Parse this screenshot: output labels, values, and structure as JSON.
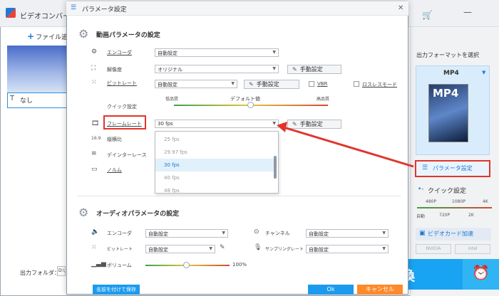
{
  "app": {
    "title": "ビデオコンバー",
    "add_file": "ファイル追",
    "subtitle_value": "なし",
    "output_folder_label": "出力フォルダ：",
    "output_folder_value": "D:\\"
  },
  "right_panel": {
    "format_title": "出力フォーマットを選択",
    "format_name": "MP4",
    "format_icon_label": "MP4",
    "param_button": "パラメータ設定",
    "quick_title": "クイック設定",
    "quick_labels": [
      "480P",
      "1080P",
      "4K",
      "自動",
      "720P",
      "2K"
    ],
    "gpu_label": "ビデオカード加速",
    "gpu_logos": [
      "NVIDIA",
      "intel"
    ],
    "convert_label": "変換"
  },
  "dialog": {
    "title": "パラメータ設定",
    "video_section": "動画パラメータの設定",
    "encoder_label": "エンコーダ",
    "encoder_value": "自動設定",
    "resolution_label": "解像度",
    "resolution_value": "オリジナル",
    "manual_label": "手動設定",
    "bitrate_label": "ビットレート",
    "bitrate_value": "自動設定",
    "vbr_label": "VBR",
    "lossless_label": "ロスレスモード",
    "quick_label": "クイック設定",
    "low_quality": "低品質",
    "default_value": "デフォルト値",
    "high_quality": "高品質",
    "framerate_label": "フレームレート",
    "framerate_value": "30 fps",
    "aspect_label": "縦横比",
    "deinterlace_label": "デインターレース",
    "normal_label": "ノルム",
    "framerate_options": [
      "25 fps",
      "29.97 fps",
      "30 fps",
      "40 fps",
      "48 fps"
    ],
    "framerate_selected_index": 2,
    "audio_section": "オーディオパラメータの設定",
    "a_encoder_label": "エンコーダ",
    "a_encoder_value": "自動設定",
    "channel_label": "チャンネル",
    "channel_value": "自動設定",
    "a_bitrate_label": "ビットレート",
    "a_bitrate_value": "自動設定",
    "sampling_label": "サンプリングレート",
    "sampling_value": "自動設定",
    "volume_label": "ボリューム",
    "volume_value": "100%",
    "save_as_button": "名前を付けて保存",
    "ok_button": "Ok",
    "cancel_button": "キャンセル"
  },
  "colors": {
    "accent": "#1c9bee",
    "highlight_red": "#e0352c",
    "cancel_orange": "#ff8a2b"
  }
}
